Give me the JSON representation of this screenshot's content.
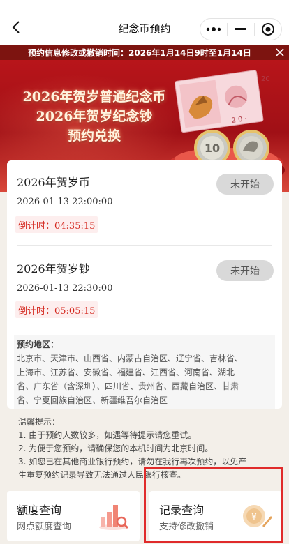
{
  "nav": {
    "title": "纪念币预约",
    "back_icon": "chevron-left-icon",
    "more_icon": "more-dots-icon",
    "minimize_icon": "minimize-icon",
    "close_icon": "target-close-icon"
  },
  "notice": {
    "text": "预约信息修改或撤销时间：2026年1月14日9时至1月14日"
  },
  "hero": {
    "line1": "2026年贺岁普通纪念币",
    "line2": "2026年贺岁纪念钞",
    "line3": "预约兑换",
    "note_value": "20",
    "coin1_value": "10"
  },
  "items": [
    {
      "name": "2026年贺岁币",
      "datetime": "2026-01-13 22:00:00",
      "countdown": "倒计时：04:35:15",
      "status": "未开始"
    },
    {
      "name": "2026年贺岁钞",
      "datetime": "2026-01-13 22:30:00",
      "countdown": "倒计时：05:05:15",
      "status": "未开始"
    }
  ],
  "region": {
    "title": "预约地区：",
    "lines": [
      "北京市、天津市、山西省、内蒙古自治区、辽宁省、吉林省、",
      "上海市、江苏省、安徽省、福建省、江西省、河南省、湖北",
      "省、广东省（含深圳）、四川省、贵州省、西藏自治区、甘肃",
      "省、宁夏回族自治区、新疆维吾尔自治区"
    ]
  },
  "tips": {
    "title": "温馨提示：",
    "lines": [
      "1. 由于预约人数较多，如遇等待提示请您重试。",
      "2. 为便于您预约，请确保您的本机时间为北京时间。",
      "3. 如您已在其他商业银行预约，请勿在我行再次预约，以免产",
      "生重复预约记录导致无法通过人民银行核查。"
    ]
  },
  "actions": [
    {
      "title": "额度查询",
      "subtitle": "网点额度查询",
      "icon": "bar-chart-search-icon"
    },
    {
      "title": "记录查询",
      "subtitle": "支持修改撤销",
      "icon": "coin-record-icon"
    }
  ],
  "colors": {
    "brand_red": "#b8151a",
    "notice_bg": "#7d1410",
    "countdown_red": "#d4281f",
    "highlight_red": "#e02b2b"
  }
}
